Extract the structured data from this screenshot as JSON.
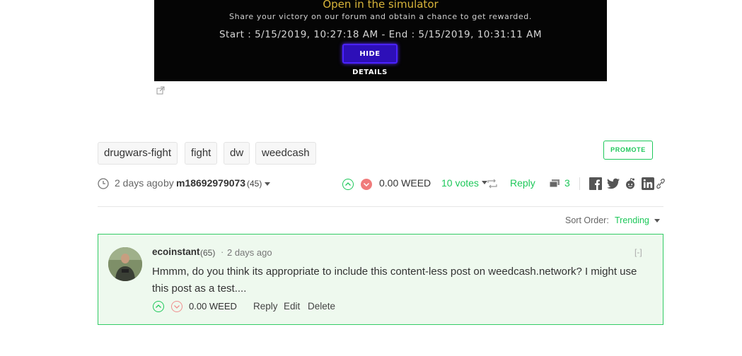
{
  "game": {
    "title": "Open in the simulator",
    "subtitle": "Share your victory on our forum and obtain a chance to get rewarded.",
    "times": "Start : 5/15/2019, 10:27:18 AM - End : 5/15/2019, 10:31:11 AM",
    "hide_button": "HIDE DETAILS"
  },
  "tags": [
    "drugwars-fight",
    "fight",
    "dw",
    "weedcash"
  ],
  "promote_label": "PROMOTE",
  "post_meta": {
    "time_ago": "2 days ago",
    "by": "by",
    "author": "m18692979073",
    "reputation": "(45)",
    "payout": "0.00 WEED",
    "votes": "10 votes",
    "reply": "Reply",
    "comments_count": "3"
  },
  "sort": {
    "label": "Sort Order:",
    "value": "Trending"
  },
  "comment": {
    "author": "ecoinstant",
    "reputation": "(65)",
    "separator": "·",
    "time_ago": "2 days ago",
    "collapse": "[-]",
    "body": "Hmmm, do you think its appropriate to include this content-less post on weedcash.network? I might use this post as a test....",
    "payout": "0.00 WEED",
    "actions": {
      "reply": "Reply",
      "edit": "Edit",
      "delete": "Delete"
    }
  },
  "colors": {
    "accent_green": "#1ec85a",
    "downvote_red": "#f07b7b",
    "comment_bg": "#eef9ee",
    "game_gold": "#d8b43a",
    "button_purple": "#2d0fb8"
  },
  "icons": [
    "external-link-icon",
    "clock-icon",
    "upvote-icon",
    "downvote-icon",
    "reblog-icon",
    "comments-icon",
    "facebook-icon",
    "twitter-icon",
    "reddit-icon",
    "linkedin-icon",
    "link-icon",
    "caret-down-icon"
  ]
}
